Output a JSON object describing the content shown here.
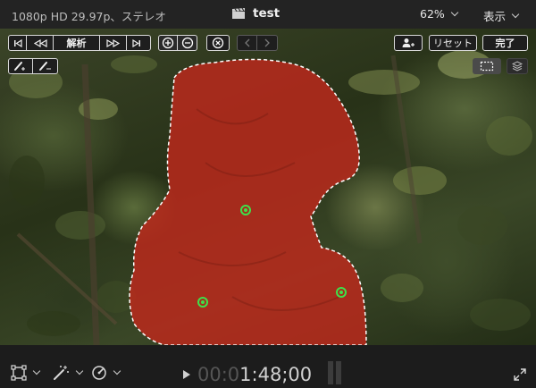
{
  "topbar": {
    "format": "1080p HD 29.97p、ステレオ",
    "project_title": "test",
    "zoom": "62%",
    "view_menu": "表示"
  },
  "toolbar": {
    "analyze_label": "解析",
    "reset_label": "リセット",
    "done_label": "完了"
  },
  "timecode": {
    "dim_part": "00:0",
    "lit_part": "1:48;00"
  },
  "icons": {
    "go_start": "skip-start-icon",
    "step_back": "rewind-icon",
    "step_forward": "fast-forward-icon",
    "go_end": "skip-end-icon",
    "add_mode": "plus-circle-icon",
    "subtract_mode": "minus-circle-icon",
    "clear": "close-circle-icon",
    "prev": "chevron-left-icon",
    "next": "chevron-right-icon",
    "add_person": "add-person-icon",
    "brush_add": "brush-plus-icon",
    "brush_subtract": "brush-minus-icon",
    "selection_overlay": "dashed-rect-icon",
    "layers": "layers-icon",
    "transform": "transform-icon",
    "magic_wand": "magic-wand-icon",
    "speed": "speed-gauge-icon",
    "fullscreen": "expand-icon"
  },
  "colors": {
    "mask": "#c0281c",
    "point": "#3ee04a",
    "background": "#1a1a1a"
  }
}
